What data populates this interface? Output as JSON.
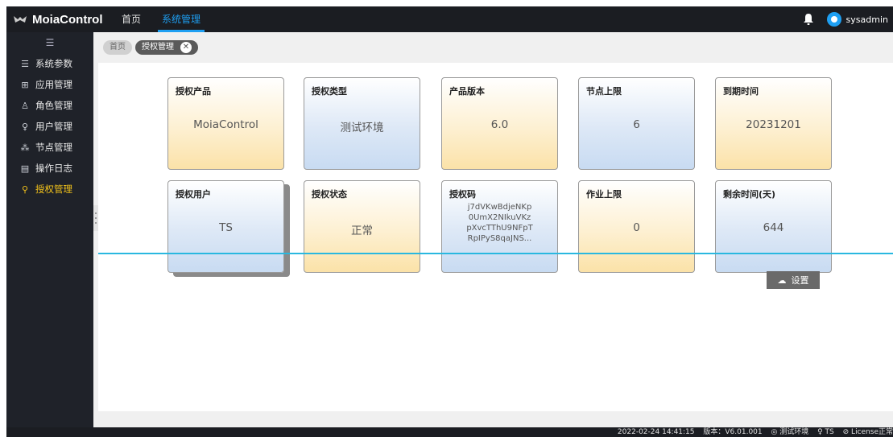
{
  "app": {
    "name": "MoiaControl"
  },
  "topnav": [
    {
      "label": "首页",
      "active": false
    },
    {
      "label": "系统管理",
      "active": true
    }
  ],
  "user": {
    "name": "sysadmin"
  },
  "sidebar": {
    "toggle_icon": "menu-collapse-icon",
    "items": [
      {
        "label": "系统参数",
        "icon": "list-icon",
        "active": false
      },
      {
        "label": "应用管理",
        "icon": "cart-icon",
        "active": false
      },
      {
        "label": "角色管理",
        "icon": "roles-icon",
        "active": false
      },
      {
        "label": "用户管理",
        "icon": "user-icon",
        "active": false
      },
      {
        "label": "节点管理",
        "icon": "nodes-icon",
        "active": false
      },
      {
        "label": "操作日志",
        "icon": "log-icon",
        "active": false
      },
      {
        "label": "授权管理",
        "icon": "key-icon",
        "active": true
      }
    ]
  },
  "tabs": {
    "home": "首页",
    "current": "授权管理",
    "close": "✕"
  },
  "cards": [
    {
      "title": "授权产品",
      "value": "MoiaControl",
      "color": "yellow"
    },
    {
      "title": "授权类型",
      "value": "测试环境",
      "color": "blue"
    },
    {
      "title": "产品版本",
      "value": "6.0",
      "color": "yellow"
    },
    {
      "title": "节点上限",
      "value": "6",
      "color": "blue"
    },
    {
      "title": "到期时间",
      "value": "20231201",
      "color": "yellow"
    },
    {
      "title": "授权用户",
      "value": "TS",
      "color": "blue"
    },
    {
      "title": "授权状态",
      "value": "正常",
      "color": "yellow"
    },
    {
      "title": "授权码",
      "code_lines": [
        "j7dVKwBdjeNKp",
        "0UmX2NIkuVKz",
        "pXvcTThU9NFpT",
        "RpIPyS8qaJNS..."
      ],
      "color": "blue"
    },
    {
      "title": "作业上限",
      "value": "0",
      "color": "yellow"
    },
    {
      "title": "剩余时间(天)",
      "value": "644",
      "color": "blue"
    }
  ],
  "set_button": {
    "label": "设置",
    "icon": "cloud-upload-icon"
  },
  "statusbar": {
    "datetime": "2022-02-24 14:41:15",
    "version": "版本：V6.01.001",
    "env": "◎ 测试环境",
    "user": "♀ TS",
    "license": "⊘ License正常"
  },
  "colors": {
    "accent": "#1e9ff2",
    "active_side": "#f2c21b",
    "divider": "#29b8e0"
  }
}
